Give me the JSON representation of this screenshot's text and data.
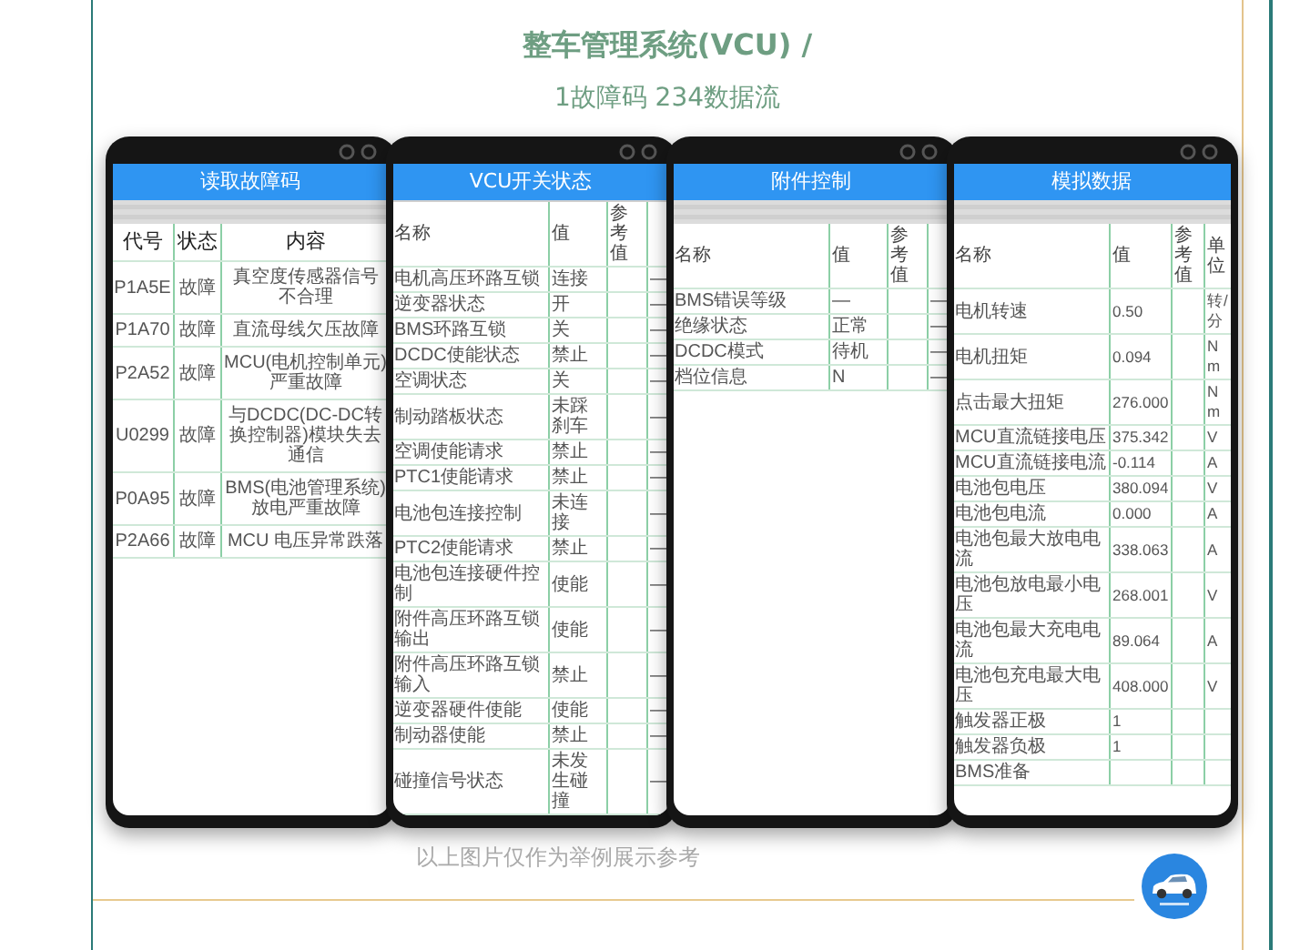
{
  "title": "整车管理系统(VCU) /",
  "subtitle": "1故障码 234数据流",
  "phones": [
    {
      "kind": "fault_codes",
      "title": "读取故障码",
      "columns": [
        "代号",
        "状态",
        "内容"
      ],
      "rows": [
        [
          "P1A5E",
          "故障",
          "真空度传感器信号不合理"
        ],
        [
          "P1A70",
          "故障",
          "直流母线欠压故障"
        ],
        [
          "P2A52",
          "故障",
          "MCU(电机控制单元)严重故障"
        ],
        [
          "U0299",
          "故障",
          "与DCDC(DC-DC转换控制器)模块失去通信"
        ],
        [
          "P0A95",
          "故障",
          "BMS(电池管理系统)放电严重故障"
        ],
        [
          "P2A66",
          "故障",
          "MCU 电压异常跌落"
        ]
      ]
    },
    {
      "kind": "data_list",
      "title": "VCU开关状态",
      "columns": [
        "名称",
        "值",
        "参考值"
      ],
      "rows": [
        [
          "电机高压环路互锁",
          "连接",
          "",
          "—"
        ],
        [
          "逆变器状态",
          "开",
          "",
          "—"
        ],
        [
          "BMS环路互锁",
          "关",
          "",
          "—"
        ],
        [
          "DCDC使能状态",
          "禁止",
          "",
          "—"
        ],
        [
          "空调状态",
          "关",
          "",
          "—"
        ],
        [
          "制动踏板状态",
          "未踩刹车",
          "",
          "—"
        ],
        [
          "空调使能请求",
          "禁止",
          "",
          "—"
        ],
        [
          "PTC1使能请求",
          "禁止",
          "",
          "—"
        ],
        [
          "电池包连接控制",
          "未连接",
          "",
          "—"
        ],
        [
          "PTC2使能请求",
          "禁止",
          "",
          "—"
        ],
        [
          "电池包连接硬件控制",
          "使能",
          "",
          "—"
        ],
        [
          "附件高压环路互锁输出",
          "使能",
          "",
          "—"
        ],
        [
          "附件高压环路互锁输入",
          "禁止",
          "",
          "—"
        ],
        [
          "逆变器硬件使能",
          "使能",
          "",
          "—"
        ],
        [
          "制动器使能",
          "禁止",
          "",
          "—"
        ],
        [
          "碰撞信号状态",
          "未发生碰撞",
          "",
          "—"
        ]
      ]
    },
    {
      "kind": "data_list",
      "title": "附件控制",
      "columns": [
        "名称",
        "值",
        "参考值"
      ],
      "rows": [
        [
          "BMS错误等级",
          "—",
          "",
          "—"
        ],
        [
          "绝缘状态",
          "正常",
          "",
          "—"
        ],
        [
          "DCDC模式",
          "待机",
          "",
          "—"
        ],
        [
          "档位信息",
          "N",
          "",
          "—"
        ]
      ]
    },
    {
      "kind": "data_list",
      "title": "模拟数据",
      "columns": [
        "名称",
        "值",
        "参考值",
        "单位"
      ],
      "rows": [
        [
          "电机转速",
          "0.50",
          "",
          "转/分"
        ],
        [
          "电机扭矩",
          "0.094",
          "",
          "Nm"
        ],
        [
          "点击最大扭矩",
          "276.000",
          "",
          "Nm"
        ],
        [
          "MCU直流链接电压",
          "375.342",
          "",
          "V"
        ],
        [
          "MCU直流链接电流",
          "-0.114",
          "",
          "A"
        ],
        [
          "电池包电压",
          "380.094",
          "",
          "V"
        ],
        [
          "电池包电流",
          "0.000",
          "",
          "A"
        ],
        [
          "电池包最大放电电流",
          "338.063",
          "",
          "A"
        ],
        [
          "电池包放电最小电压",
          "268.001",
          "",
          "V"
        ],
        [
          "电池包最大充电电流",
          "89.064",
          "",
          "A"
        ],
        [
          "电池包充电最大电压",
          "408.000",
          "",
          "V"
        ],
        [
          "触发器正极",
          "1",
          "",
          ""
        ],
        [
          "触发器负极",
          "1",
          "",
          ""
        ],
        [
          "BMS准备",
          "",
          "",
          ""
        ]
      ]
    }
  ],
  "caption": "以上图片仅作为举例展示参考"
}
